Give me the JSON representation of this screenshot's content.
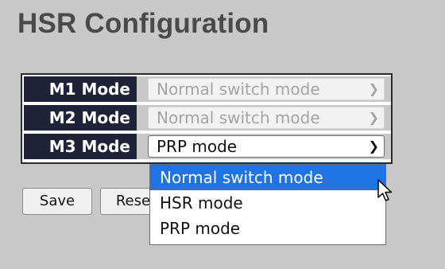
{
  "page": {
    "title": "HSR Configuration"
  },
  "modes": [
    {
      "label": "M1 Mode",
      "value": "Normal switch mode",
      "enabled": false
    },
    {
      "label": "M2 Mode",
      "value": "Normal switch mode",
      "enabled": false
    },
    {
      "label": "M3 Mode",
      "value": "PRP mode",
      "enabled": true
    }
  ],
  "dropdown": {
    "options": [
      "Normal switch mode",
      "HSR mode",
      "PRP mode"
    ],
    "highlighted": "Normal switch mode"
  },
  "buttons": {
    "save": "Save",
    "reset": "Reset"
  },
  "colors": {
    "background": "#c8c8c8",
    "label_bg": "#1f2338",
    "highlight": "#1e74e6",
    "title": "#4a4a4a"
  },
  "icons": {
    "chevron": "chevron-down-icon",
    "cursor": "mouse-pointer-icon"
  }
}
